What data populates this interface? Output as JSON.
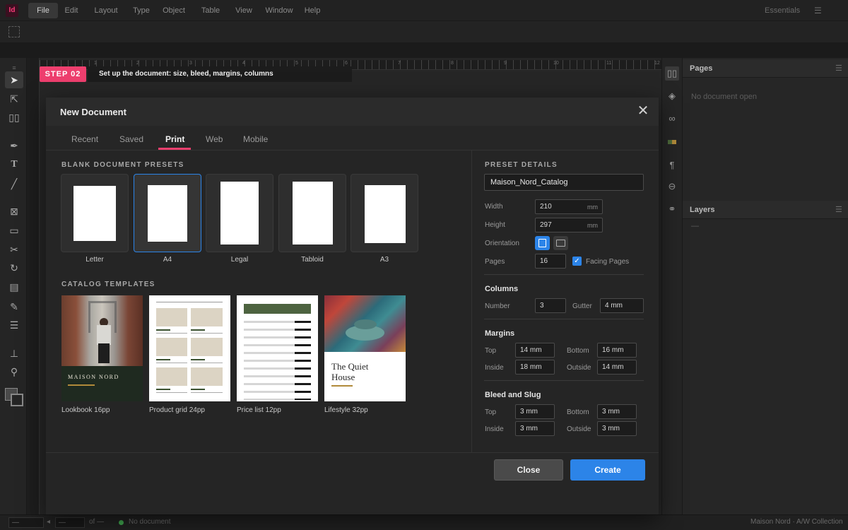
{
  "app": {
    "logo": "Id",
    "menu": [
      "File",
      "Edit",
      "Layout",
      "Type",
      "Object",
      "Table",
      "View",
      "Window",
      "Help"
    ],
    "workspace": "Essentials"
  },
  "ruler": [
    "1",
    "2",
    "3",
    "4",
    "5",
    "6",
    "7",
    "8",
    "9",
    "10",
    "11",
    "12"
  ],
  "step": {
    "badge": "STEP 02",
    "text": "Set up the document: size, bleed, margins, columns"
  },
  "panels": {
    "pages": {
      "title": "Pages",
      "empty": "No document open"
    },
    "layers": {
      "title": "Layers",
      "empty": "—"
    }
  },
  "status": {
    "page_field": "—",
    "page_field2": "—",
    "of": "of —",
    "state": "No document",
    "right": "Maison Nord · A/W Collection"
  },
  "dialog": {
    "title": "New Document",
    "tabs": [
      "Recent",
      "Saved",
      "Print",
      "Web",
      "Mobile"
    ],
    "active_tab": "Print",
    "presets_label": "BLANK DOCUMENT PRESETS",
    "presets": [
      "Letter",
      "A4",
      "Legal",
      "Tabloid",
      "A3"
    ],
    "selected_preset": "A4",
    "templates_label": "CATALOG TEMPLATES",
    "templates": [
      {
        "label": "Lookbook 16pp",
        "brand": "MAISON NORD"
      },
      {
        "label": "Product grid 24pp"
      },
      {
        "label": "Price list 12pp"
      },
      {
        "label": "Lifestyle 32pp",
        "headline": "The Quiet House"
      }
    ],
    "details": {
      "label": "PRESET DETAILS",
      "name": "Maison_Nord_Catalog",
      "width_label": "Width",
      "width": "210",
      "width_unit": "mm",
      "height_label": "Height",
      "height": "297",
      "height_unit": "mm",
      "orientation_label": "Orientation",
      "orientation": "portrait",
      "pages_label": "Pages",
      "pages": "16",
      "facing_label": "Facing Pages",
      "facing": true,
      "columns_title": "Columns",
      "number_label": "Number",
      "number": "3",
      "gutter_label": "Gutter",
      "gutter": "4 mm",
      "margins_title": "Margins",
      "m_top_label": "Top",
      "m_top": "14 mm",
      "m_bottom_label": "Bottom",
      "m_bottom": "16 mm",
      "m_inside_label": "Inside",
      "m_inside": "18 mm",
      "m_outside_label": "Outside",
      "m_outside": "14 mm",
      "bleed_title": "Bleed and Slug",
      "b_top_label": "Top",
      "b_top": "3 mm",
      "b_bottom_label": "Bottom",
      "b_bottom": "3 mm",
      "b_inside_label": "Inside",
      "b_inside": "3 mm",
      "b_outside_label": "Outside",
      "b_outside": "3 mm"
    },
    "close_label": "Close",
    "create_label": "Create"
  },
  "colors": {
    "accent": "#ee3f6e",
    "primary": "#2c84e8",
    "template_green": "#3b5230",
    "gold": "#b08a3a"
  }
}
